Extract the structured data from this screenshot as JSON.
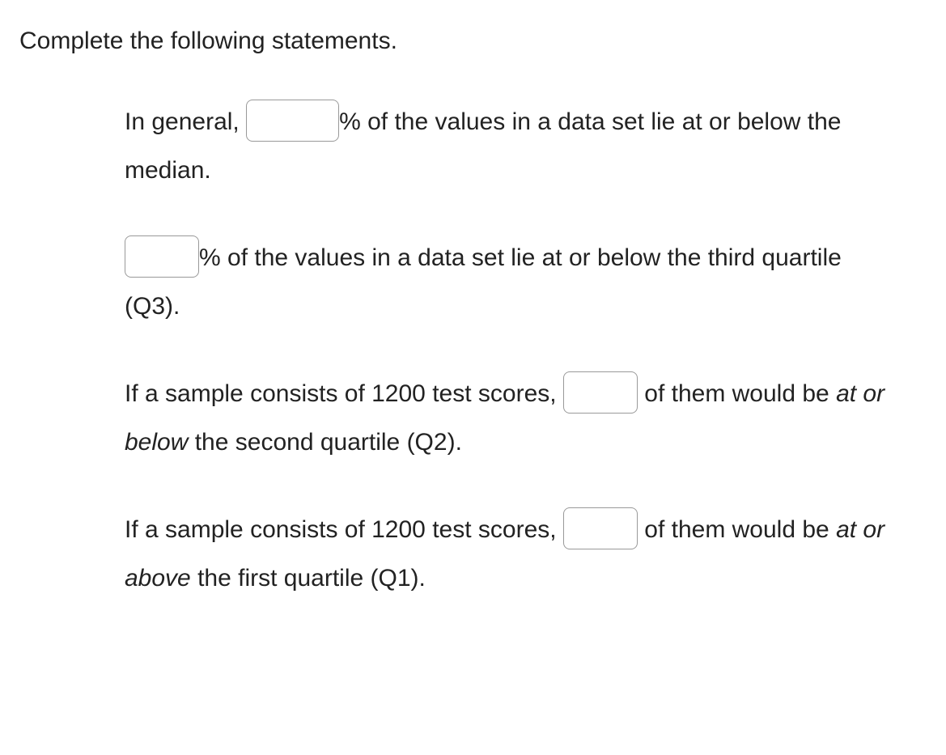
{
  "instruction": "Complete the following statements.",
  "statement1": {
    "part1": "In general, ",
    "part2": "% of the values in a data set lie at or below the median."
  },
  "statement2": {
    "part1": "",
    "part2": "% of the values in a data set lie at or below the third quartile (Q3)."
  },
  "statement3": {
    "part1": "If a sample consists of 1200 test scores, ",
    "part2": " of them would be ",
    "italic": "at or below",
    "part3": " the second quartile (Q2)."
  },
  "statement4": {
    "part1": "If a sample consists of 1200 test scores, ",
    "part2": " of them would be ",
    "italic": "at or above",
    "part3": " the first quartile (Q1)."
  }
}
